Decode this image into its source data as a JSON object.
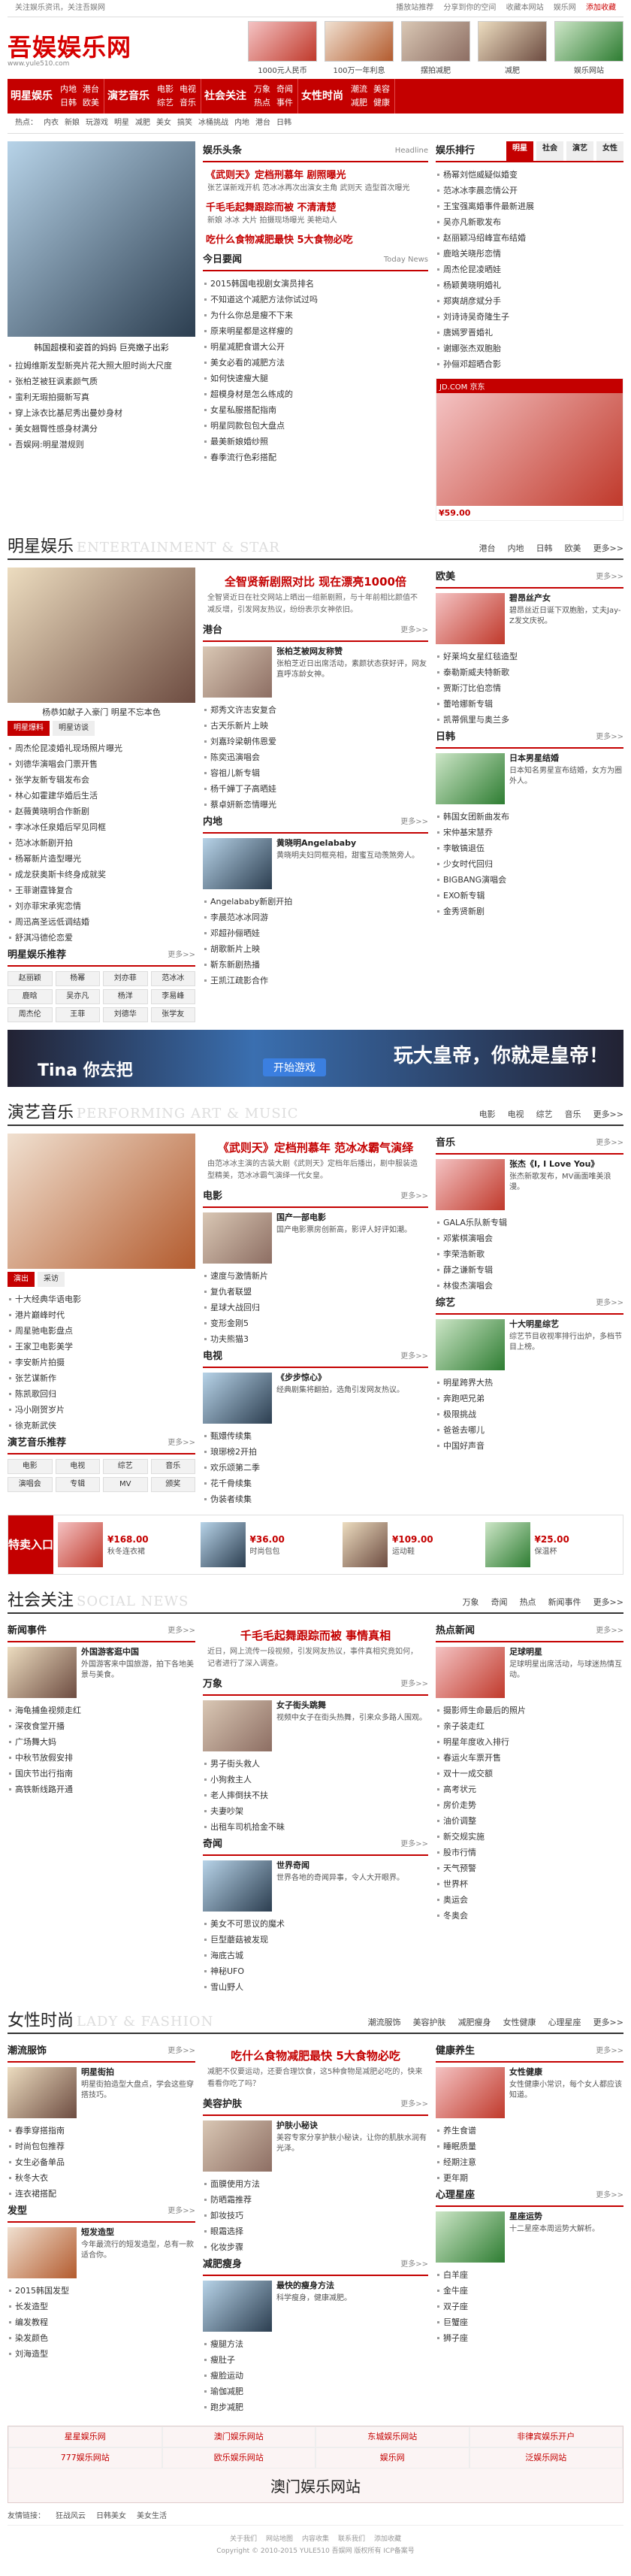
{
  "topbar": {
    "left": "关注娱乐资讯，关注吾娱网",
    "links": [
      "播放站推荐",
      "分享到你的空间",
      "收藏本网站",
      "娱乐网",
      "添加收藏"
    ]
  },
  "logo": {
    "name_a": "吾娱",
    "name_b": "娱乐网",
    "url": "www.yule510.com"
  },
  "header_ads": [
    "1000元人民币",
    "100万一年利息",
    "摆拍减肥",
    "减肥",
    "娱乐网站"
  ],
  "nav": [
    {
      "main": "明星娱乐",
      "subs": [
        "内地",
        "港台",
        "日韩",
        "欧美"
      ]
    },
    {
      "main": "演艺音乐",
      "subs": [
        "电影",
        "电视",
        "综艺",
        "音乐"
      ]
    },
    {
      "main": "社会关注",
      "subs": [
        "万象",
        "奇闻",
        "热点",
        "事件"
      ]
    },
    {
      "main": "女性时尚",
      "subs": [
        "潮流",
        "美容",
        "减肥",
        "健康"
      ]
    }
  ],
  "subnav": [
    "热点：",
    "内衣",
    "新娘",
    "玩游戏",
    "明星",
    "减肥",
    "美女",
    "搞笑",
    "冰桶挑战",
    "内地",
    "港台",
    "日韩"
  ],
  "top": {
    "photo_caption": "韩国超模和姿首的妈妈 巨亮嫩子出彩",
    "left_list": [
      "拉姆维斯发型新亮片花大照大胆时尚大尺度",
      "张柏芝被狂讽素颜气质",
      "蛮利无瑕拍摄新写真",
      "穿上泳衣比基尼秀出曼妙身材",
      "美女翘臀性感身材满分",
      "吾娱网:明星潜规则"
    ],
    "yl_title": "娱乐头条",
    "yl_items": [
      {
        "head": "《武则天》定档刑慕年 剧照曝光",
        "body": "张艺谋新戏开机 范冰冰再次出演女主角 武则天 造型首次曝光"
      },
      {
        "head": "千毛毛起舞跟踪而被 不清清楚",
        "body": "新娘 冰冰 大片 拍摄现场曝光 美艳动人"
      },
      {
        "head": "吃什么食物减肥最快 5大食物必吃",
        "body": ""
      }
    ],
    "today_title": "今日要闻",
    "today_list": [
      "2015韩国电视剧女演员排名",
      "不知道这个减肥方法你试过吗",
      "为什么你总是瘦不下来",
      "原来明星都是这样瘦的",
      "明星减肥食谱大公开",
      "美女必看的减肥方法",
      "如何快速瘦大腿",
      "超模身材是怎么练成的",
      "女星私服搭配指南",
      "明星同款包包大盘点",
      "最美新娘婚纱照",
      "春季流行色彩搭配"
    ],
    "rank_title": "娱乐排行",
    "rank_tabs": [
      "明星",
      "社会",
      "演艺",
      "女性"
    ],
    "rank_list": [
      "杨幂刘恺威疑似婚变",
      "范冰冰李晨恋情公开",
      "王宝强离婚事件最新进展",
      "吴亦凡新歌发布",
      "赵丽颖冯绍峰宣布结婚",
      "鹿晗关晓彤恋情",
      "周杰伦昆凌晒娃",
      "杨颖黄晓明婚礼",
      "郑爽胡彦斌分手",
      "刘诗诗吴奇隆生子",
      "唐嫣罗晋婚礼",
      "谢娜张杰双胞胎",
      "孙俪邓超晒合影"
    ],
    "shop_price": "¥59.00",
    "shop_label": "JD.COM 京东"
  },
  "s1": {
    "title": "明星娱乐",
    "en": "ENTERTAINMENT & STAR",
    "tabs": [
      "港台",
      "内地",
      "日韩",
      "欧美",
      "更多>>"
    ],
    "photo_caption": "杨恭如献子入豪门 明星不忘本色",
    "red_tabs": [
      "明星爆料",
      "明星访谈"
    ],
    "list": [
      "周杰伦昆凌婚礼现场照片曝光",
      "刘德华演唱会门票开售",
      "张学友新专辑发布会",
      "林心如霍建华婚后生活",
      "赵薇黄晓明合作新剧",
      "李冰冰任泉婚后罕见同框",
      "范冰冰新剧开拍",
      "杨幂新片造型曝光",
      "成龙获奥斯卡终身成就奖",
      "王菲谢霆锋复合",
      "刘亦菲宋承宪恋情",
      "周迅高圣远低调结婚",
      "舒淇冯德伦恋爱"
    ],
    "tags_title": "明星娱乐推荐",
    "tags": [
      "赵丽颖",
      "杨幂",
      "刘亦菲",
      "范冰冰",
      "鹿晗",
      "吴亦凡",
      "杨洋",
      "李易峰",
      "周杰伦",
      "王菲",
      "刘德华",
      "张学友"
    ],
    "center_head": "全智贤新剧照对比 现在漂亮1000倍",
    "center_sum": "全智贤近日在社交网站上晒出一组新剧照，与十年前相比颜值不减反增，引发网友热议，纷纷表示女神依旧。",
    "mid_title": "港台",
    "mid_item": {
      "t": "张柏芝被网友称赞",
      "d": "张柏芝近日出席活动，素颜状态获好评，网友直呼冻龄女神。"
    },
    "mid_list": [
      "郑秀文许志安复合",
      "古天乐新片上映",
      "刘嘉玲梁朝伟恩爱",
      "陈奕迅演唱会",
      "容祖儿新专辑",
      "杨千嬅丁子高晒娃",
      "蔡卓妍新恋情曝光"
    ],
    "mid2_title": "内地",
    "mid2_item": {
      "t": "黄晓明Angelababy",
      "d": "黄晓明夫妇同框亮相，甜蜜互动羡煞旁人。"
    },
    "mid2_list": [
      "Angelababy新剧开拍",
      "李晨范冰冰同游",
      "邓超孙俪晒娃",
      "胡歌新片上映",
      "靳东新剧热播",
      "王凯江疏影合作"
    ],
    "r_title": "欧美",
    "r_item": {
      "t": "碧昂丝产女",
      "d": "碧昂丝近日诞下双胞胎，丈夫Jay-Z发文庆祝。"
    },
    "r_list": [
      "好莱坞女星红毯造型",
      "泰勒斯威夫特新歌",
      "贾斯汀比伯恋情",
      "蕾哈娜新专辑",
      "凯蒂佩里与奥兰多"
    ],
    "r2_title": "日韩",
    "r2_item": {
      "t": "日本男星结婚",
      "d": "日本知名男星宣布结婚，女方为圈外人。"
    },
    "r2_list": [
      "韩国女团新曲发布",
      "宋仲基宋慧乔",
      "李敏镐退伍",
      "少女时代回归",
      "BIGBANG演唱会",
      "EXO新专辑",
      "金秀贤新剧"
    ]
  },
  "banner1": {
    "left": "Tina 你去把",
    "btn": "开始游戏",
    "right": "玩大皇帝，你就是皇帝！"
  },
  "s2": {
    "title": "演艺音乐",
    "en": "PERFORMING ART & MUSIC",
    "tabs": [
      "电影",
      "电视",
      "综艺",
      "音乐",
      "更多>>"
    ],
    "red_tabs": [
      "演出",
      "采访"
    ],
    "list": [
      "十大经典华语电影",
      "港片巅峰时代",
      "周星驰电影盘点",
      "王家卫电影美学",
      "李安新片拍摄",
      "张艺谋新作",
      "陈凯歌回归",
      "冯小刚贺岁片",
      "徐克新武侠"
    ],
    "tags_title": "演艺音乐推荐",
    "tags": [
      "电影",
      "电视",
      "综艺",
      "音乐",
      "演唱会",
      "专辑",
      "MV",
      "颁奖"
    ],
    "center_head": "《武则天》定档刑慕年 范冰冰霸气演绎",
    "center_sum": "由范冰冰主演的古装大剧《武则天》定档年后播出，剧中服装造型精美，范冰冰霸气演绎一代女皇。",
    "mid_title": "电影",
    "mid_item": {
      "t": "国产一部电影",
      "d": "国产电影票房创新高，影评人好评如潮。"
    },
    "mid_list": [
      "速度与激情新片",
      "复仇者联盟",
      "星球大战回归",
      "变形金刚5",
      "功夫熊猫3"
    ],
    "mid2_title": "电视",
    "mid2_item": {
      "t": "《步步惊心》",
      "d": "经典剧集将翻拍，选角引发网友热议。"
    },
    "mid2_list": [
      "甄嬛传续集",
      "琅琊榜2开拍",
      "欢乐颂第二季",
      "花千骨续集",
      "伪装者续集"
    ],
    "r_title": "音乐",
    "r_item": {
      "t": "张杰《I, I Love You》",
      "d": "张杰新歌发布，MV画面唯美浪漫。"
    },
    "r_list": [
      "GALA乐队新专辑",
      "邓紫棋演唱会",
      "李荣浩新歌",
      "薛之谦新专辑",
      "林俊杰演唱会"
    ],
    "r2_title": "综艺",
    "r2_item": {
      "t": "十大明星综艺",
      "d": "综艺节目收视率排行出炉，多档节目上榜。"
    },
    "r2_list": [
      "明星跨界大热",
      "奔跑吧兄弟",
      "极限挑战",
      "爸爸去哪儿",
      "中国好声音"
    ]
  },
  "shop": {
    "lead": "特卖入口",
    "items": [
      {
        "p": "¥168.00",
        "d": "秋冬连衣裙"
      },
      {
        "p": "¥36.00",
        "d": "时尚包包"
      },
      {
        "p": "¥109.00",
        "d": "运动鞋"
      },
      {
        "p": "¥25.00",
        "d": "保温杯"
      }
    ]
  },
  "s3": {
    "title": "社会关注",
    "en": "SOCIAL NEWS",
    "tabs": [
      "万象",
      "奇闻",
      "热点",
      "新闻事件",
      "更多>>"
    ],
    "l_title": "新闻事件",
    "l_item": {
      "t": "外国游客逛中国",
      "d": "外国游客来中国旅游，拍下各地美景与美食。"
    },
    "l_list": [
      "海龟捕鱼视频走红",
      "深夜食堂开播",
      "广场舞大妈",
      "中秋节放假安排",
      "国庆节出行指南",
      "高铁新线路开通"
    ],
    "center_head": "千毛毛起舞跟踪而被 事情真相",
    "center_sum": "近日，网上流传一段视频，引发网友热议，事件真相究竟如何，记者进行了深入调查。",
    "mid_title": "万象",
    "mid_item": {
      "t": "女子街头跳舞",
      "d": "视频中女子在街头热舞，引来众多路人围观。"
    },
    "mid_list": [
      "男子街头救人",
      "小狗救主人",
      "老人摔倒扶不扶",
      "夫妻吵架",
      "出租车司机拾金不昧"
    ],
    "mid2_title": "奇闻",
    "mid2_item": {
      "t": "世界奇闻",
      "d": "世界各地的奇闻异事，令人大开眼界。"
    },
    "mid2_list": [
      "美女不可思议的魔术",
      "巨型蘑菇被发现",
      "海底古城",
      "神秘UFO",
      "雪山野人"
    ],
    "r_title": "热点新闻",
    "r_list": [
      "摄影师生命最后的照片",
      "亲子装走红",
      "明星年度收入排行",
      "春运火车票开售",
      "双十一成交额",
      "高考状元",
      "房价走势",
      "油价调整",
      "新交规实施",
      "股市行情",
      "天气预警",
      "世界杯",
      "奥运会",
      "冬奥会"
    ],
    "r_item": {
      "t": "足球明星",
      "d": "足球明星出席活动，与球迷热情互动。"
    }
  },
  "s4": {
    "title": "女性时尚",
    "en": "LADY & FASHION",
    "tabs": [
      "潮流服饰",
      "美容护肤",
      "减肥瘦身",
      "女性健康",
      "心理星座",
      "更多>>"
    ],
    "l_title": "潮流服饰",
    "l_item": {
      "t": "明星街拍",
      "d": "明星街拍造型大盘点，学会这些穿搭技巧。"
    },
    "l_list": [
      "春季穿搭指南",
      "时尚包包推荐",
      "女生必备单品",
      "秋冬大衣",
      "连衣裙搭配"
    ],
    "l2_title": "发型",
    "l2_item": {
      "t": "短发造型",
      "d": "今年最流行的短发造型，总有一款适合你。"
    },
    "l2_list": [
      "2015韩国发型",
      "长发造型",
      "编发教程",
      "染发颜色",
      "刘海造型"
    ],
    "center_head": "吃什么食物减肥最快 5大食物必吃",
    "center_sum": "减肥不仅要运动，还要合理饮食，这5种食物是减肥必吃的，快来看看你吃了吗？",
    "mid_title": "美容护肤",
    "mid_item": {
      "t": "护肤小秘诀",
      "d": "美容专家分享护肤小秘诀，让你的肌肤水润有光泽。"
    },
    "mid_list": [
      "面膜使用方法",
      "防晒霜推荐",
      "卸妆技巧",
      "眼霜选择",
      "化妆步骤"
    ],
    "mid2_title": "减肥瘦身",
    "mid2_item": {
      "t": "最快的瘦身方法",
      "d": "科学瘦身，健康减肥。"
    },
    "mid2_list": [
      "瘦腿方法",
      "瘦肚子",
      "瘦脸运动",
      "瑜伽减肥",
      "跑步减肥"
    ],
    "r_title": "健康养生",
    "r_item": {
      "t": "女性健康",
      "d": "女性健康小常识，每个女人都应该知道。"
    },
    "r_list": [
      "养生食谱",
      "睡眠质量",
      "经期注意",
      "更年期"
    ],
    "r2_title": "心理星座",
    "r2_item": {
      "t": "星座运势",
      "d": "十二星座本周运势大解析。"
    },
    "r2_list": [
      "白羊座",
      "金牛座",
      "双子座",
      "巨蟹座",
      "狮子座"
    ]
  },
  "footer": {
    "links": [
      "星星娱乐网",
      "澳门娱乐网站",
      "东城娱乐网站",
      "非律宾娱乐开户",
      "777娱乐网站",
      "欧乐娱乐网站",
      "娱乐网",
      "泛娱乐网站"
    ],
    "big": "澳门娱乐网站",
    "friends": [
      "友情链接：",
      "狂战风云",
      "日韩美女",
      "美女生活"
    ],
    "bottom_links": [
      "关于我们",
      "网站地图",
      "内容收集",
      "联系我们",
      "添加收藏"
    ],
    "copyright": "Copyright © 2010-2015 YULE510 吾娱网 版权所有 ICP备案号"
  }
}
